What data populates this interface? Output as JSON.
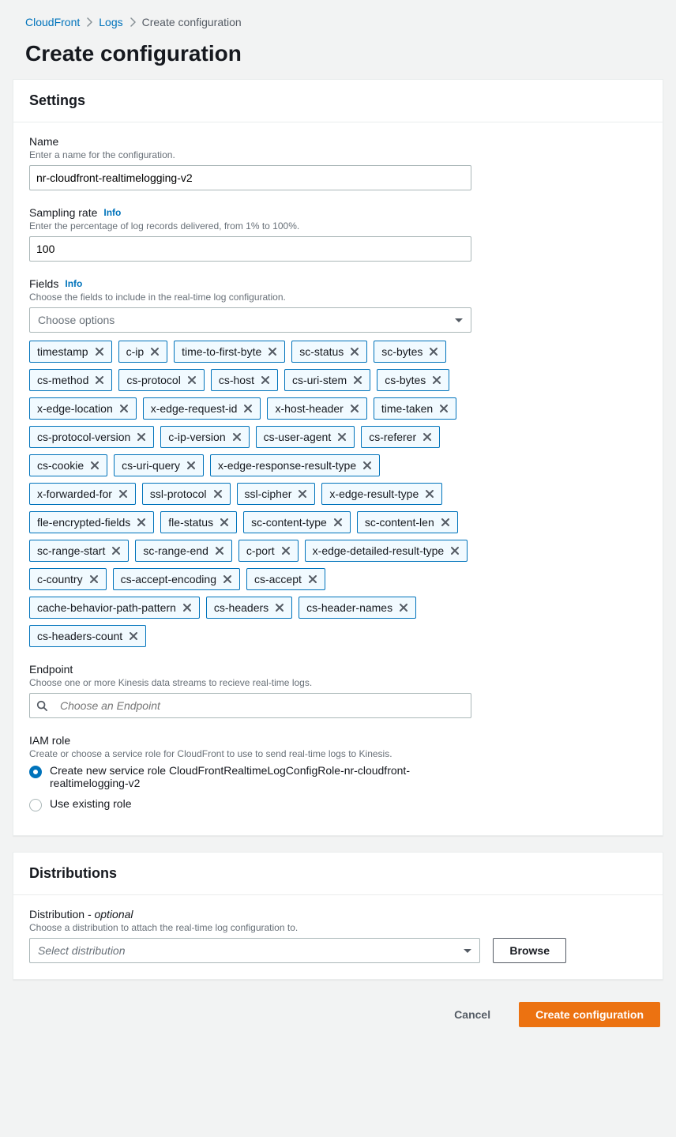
{
  "breadcrumb": {
    "root": "CloudFront",
    "mid": "Logs",
    "current": "Create configuration"
  },
  "page_title": "Create configuration",
  "info_label": "Info",
  "settings": {
    "title": "Settings",
    "name": {
      "label": "Name",
      "hint": "Enter a name for the configuration.",
      "value": "nr-cloudfront-realtimelogging-v2"
    },
    "sampling": {
      "label": "Sampling rate",
      "hint": "Enter the percentage of log records delivered, from 1% to 100%.",
      "value": "100"
    },
    "fields": {
      "label": "Fields",
      "hint": "Choose the fields to include in the real-time log configuration.",
      "placeholder": "Choose options",
      "items": [
        "timestamp",
        "c-ip",
        "time-to-first-byte",
        "sc-status",
        "sc-bytes",
        "cs-method",
        "cs-protocol",
        "cs-host",
        "cs-uri-stem",
        "cs-bytes",
        "x-edge-location",
        "x-edge-request-id",
        "x-host-header",
        "time-taken",
        "cs-protocol-version",
        "c-ip-version",
        "cs-user-agent",
        "cs-referer",
        "cs-cookie",
        "cs-uri-query",
        "x-edge-response-result-type",
        "x-forwarded-for",
        "ssl-protocol",
        "ssl-cipher",
        "x-edge-result-type",
        "fle-encrypted-fields",
        "fle-status",
        "sc-content-type",
        "sc-content-len",
        "sc-range-start",
        "sc-range-end",
        "c-port",
        "x-edge-detailed-result-type",
        "c-country",
        "cs-accept-encoding",
        "cs-accept",
        "cache-behavior-path-pattern",
        "cs-headers",
        "cs-header-names",
        "cs-headers-count"
      ]
    },
    "endpoint": {
      "label": "Endpoint",
      "hint": "Choose one or more Kinesis data streams to recieve real-time logs.",
      "placeholder": "Choose an Endpoint"
    },
    "iam": {
      "label": "IAM role",
      "hint": "Create or choose a service role for CloudFront to use to send real-time logs to Kinesis.",
      "option_create": "Create new service role CloudFrontRealtimeLogConfigRole-nr-cloudfront-realtimelogging-v2",
      "option_existing": "Use existing role"
    }
  },
  "distributions": {
    "title": "Distributions",
    "label": "Distribution",
    "optional": " - optional",
    "hint": "Choose a distribution to attach the real-time log configuration to.",
    "placeholder": "Select distribution",
    "browse": "Browse"
  },
  "footer": {
    "cancel": "Cancel",
    "submit": "Create configuration"
  }
}
